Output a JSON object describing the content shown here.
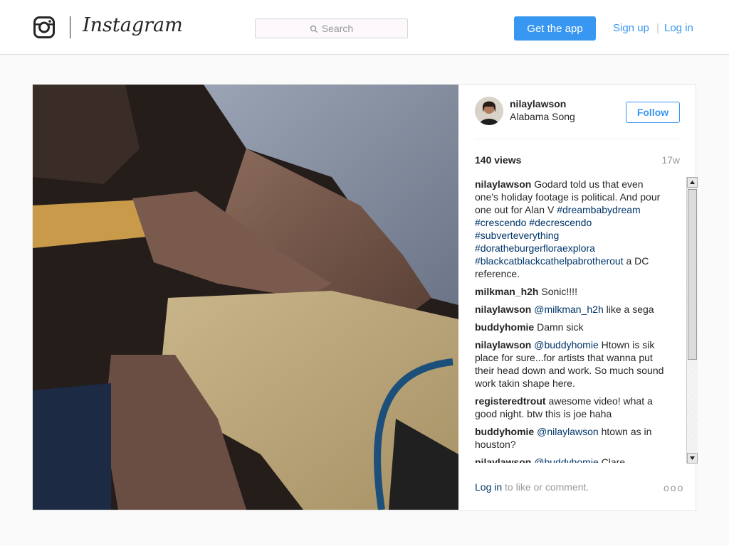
{
  "header": {
    "logo_icon": "instagram-glyph-icon",
    "wordmark": "Instagram",
    "search_placeholder": "Search",
    "get_app_label": "Get the app",
    "signup_label": "Sign up",
    "separator": "|",
    "login_label": "Log in"
  },
  "post": {
    "author": "nilaylawson",
    "location": "Alabama Song",
    "follow_label": "Follow",
    "views": "140 views",
    "time_ago": "17w",
    "comments": [
      {
        "user": "nilaylawson",
        "parts": [
          {
            "t": "text",
            "v": "Godard told us that even one's holiday footage is political. And pour one out for Alan V   "
          },
          {
            "t": "tag",
            "v": "#dreambabydream"
          },
          {
            "t": "text",
            "v": " "
          },
          {
            "t": "tag",
            "v": "#crescendo"
          },
          {
            "t": "text",
            "v": " "
          },
          {
            "t": "tag",
            "v": "#decrescendo"
          },
          {
            "t": "text",
            "v": " "
          },
          {
            "t": "tag",
            "v": "#subverteverything"
          },
          {
            "t": "text",
            "v": " "
          },
          {
            "t": "tag",
            "v": "#doratheburgerfloraexplora"
          },
          {
            "t": "text",
            "v": " "
          },
          {
            "t": "tag",
            "v": "#blackcatblackcathelpabrotherout"
          },
          {
            "t": "text",
            "v": " a DC reference."
          }
        ]
      },
      {
        "user": "milkman_h2h",
        "parts": [
          {
            "t": "text",
            "v": "Sonic!!!!"
          }
        ]
      },
      {
        "user": "nilaylawson",
        "parts": [
          {
            "t": "mention",
            "v": "@milkman_h2h"
          },
          {
            "t": "text",
            "v": " like a sega"
          }
        ]
      },
      {
        "user": "buddyhomie",
        "parts": [
          {
            "t": "text",
            "v": "Damn sick"
          }
        ]
      },
      {
        "user": "nilaylawson",
        "parts": [
          {
            "t": "mention",
            "v": "@buddyhomie"
          },
          {
            "t": "text",
            "v": " Htown is sik place for sure...for artists that wanna put their head down and work. So much sound work takin shape here."
          }
        ]
      },
      {
        "user": "registeredtrout",
        "parts": [
          {
            "t": "text",
            "v": "awesome video! what a good night. btw this is joe haha"
          }
        ]
      },
      {
        "user": "buddyhomie",
        "parts": [
          {
            "t": "mention",
            "v": "@nilaylawson"
          },
          {
            "t": "text",
            "v": " htown as in houston?"
          }
        ]
      },
      {
        "user": "nilaylawson",
        "parts": [
          {
            "t": "mention",
            "v": "@buddyhomie"
          },
          {
            "t": "text",
            "v": " Clare"
          }
        ]
      }
    ],
    "footer_login": "Log in",
    "footer_text": " to like or comment.",
    "more_label": "ooo"
  }
}
